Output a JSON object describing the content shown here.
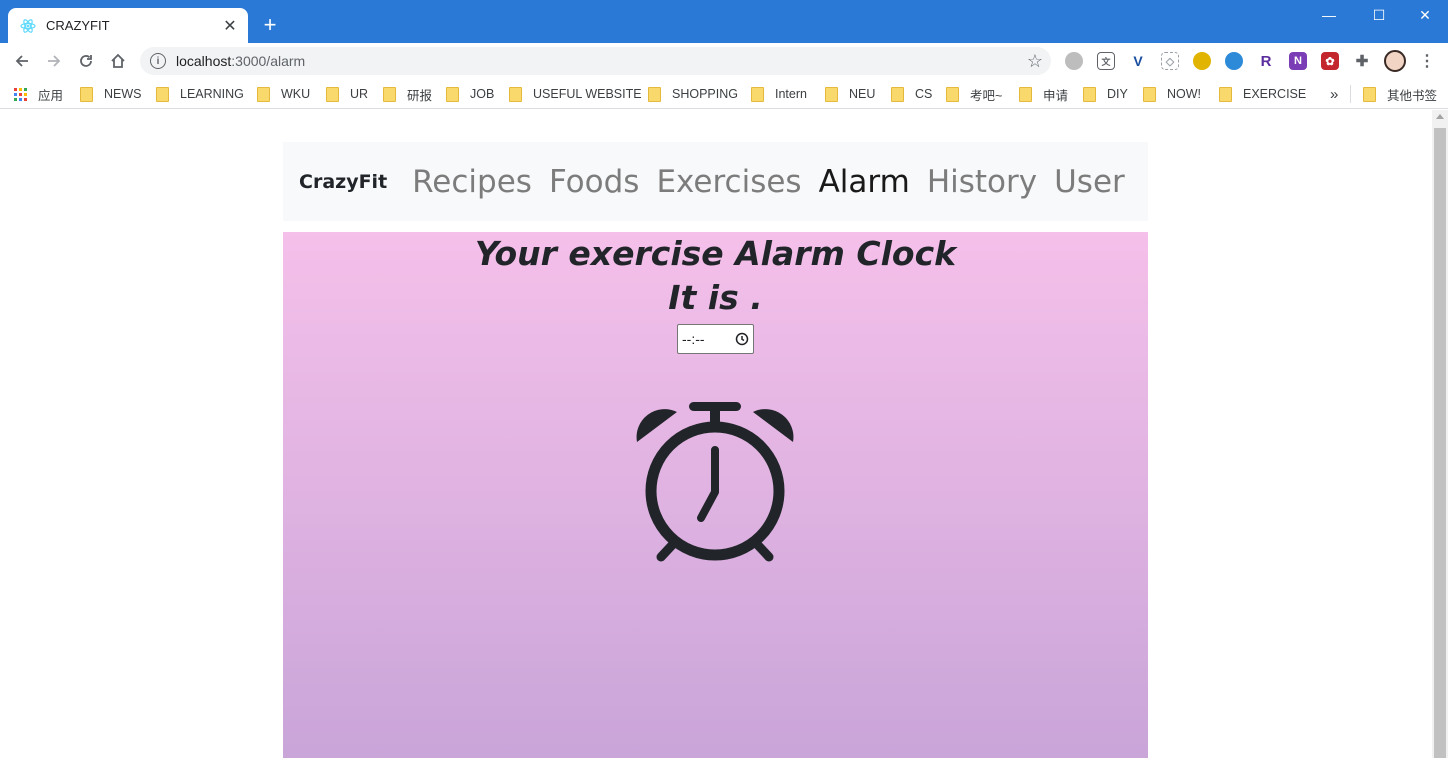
{
  "browser": {
    "tab_title": "CRAZYFIT",
    "tab_close": "✕",
    "new_tab": "+",
    "url_host": "localhost",
    "url_path": ":3000/alarm",
    "window_controls": {
      "minimize": "—",
      "maximize": "☐",
      "close": "✕"
    }
  },
  "bookmarks": {
    "apps_label": "应用",
    "items": [
      "NEWS",
      "LEARNING",
      "WKU",
      "UR",
      "研报",
      "JOB",
      "USEFUL WEBSITE",
      "SHOPPING",
      "Intern",
      "NEU",
      "CS",
      "考吧~",
      "申请",
      "DIY",
      "NOW!",
      "EXERCISE"
    ],
    "overflow": "»",
    "other_label": "其他书签"
  },
  "navbar": {
    "brand": "CrazyFit",
    "links": [
      "Recipes",
      "Foods",
      "Exercises",
      "Alarm",
      "History",
      "User"
    ],
    "active": "Alarm"
  },
  "alarm": {
    "title": "Your exercise Alarm Clock",
    "current_time_text": "It is .",
    "time_input_value": "--:--",
    "icon": "alarm-clock-icon"
  },
  "colors": {
    "titlebar": "#2b79d6",
    "gradient_top": "#f5c0ea",
    "gradient_bottom": "#c8a4d8",
    "navbar_bg": "#f8f9fa"
  }
}
